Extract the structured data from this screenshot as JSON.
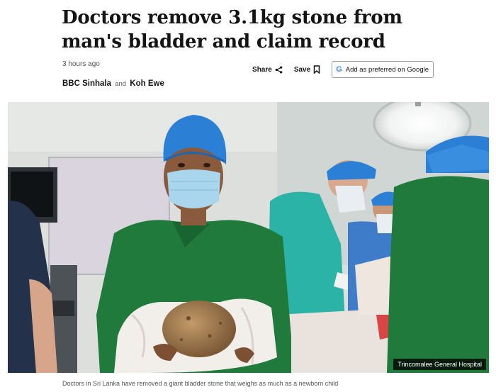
{
  "article": {
    "headline": "Doctors remove 3.1kg stone from man's bladder and claim record",
    "timestamp": "3 hours ago",
    "authors": [
      "BBC Sinhala",
      "Koh Ewe"
    ],
    "author_separator": "and"
  },
  "actions": {
    "share_label": "Share",
    "share_icon": "share-icon",
    "save_label": "Save",
    "save_icon": "bookmark-icon",
    "google_pref_label": "Add as preferred on Google",
    "google_icon": "google-g-icon"
  },
  "image": {
    "credit": "Trincomalee General Hospital",
    "caption": "Doctors in Sri Lanka have removed a giant bladder stone that weighs as much as a newborn child"
  },
  "colors": {
    "text": "#141414",
    "muted": "#545658",
    "scrub_green": "#1f7a3c",
    "cap_blue": "#2b7fd4"
  }
}
